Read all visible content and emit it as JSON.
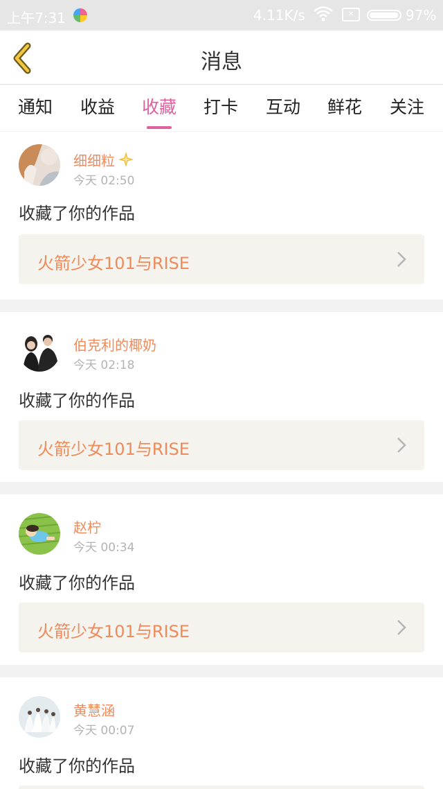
{
  "status_bar": {
    "time": "上午7:31",
    "net_speed": "4.11K/s",
    "sim_label": "✕",
    "battery_percent": 97,
    "battery_text": "97%",
    "icons": [
      "app-notification-icon",
      "wifi-icon",
      "sim-icon",
      "battery-icon"
    ]
  },
  "header": {
    "back_icon": "chevron-left-icon",
    "title": "消息"
  },
  "tabs": [
    {
      "label": "通知"
    },
    {
      "label": "收益"
    },
    {
      "label": "收藏",
      "active": true
    },
    {
      "label": "打卡"
    },
    {
      "label": "互动"
    },
    {
      "label": "鲜花"
    },
    {
      "label": "关注"
    }
  ],
  "messages": [
    {
      "user": "细细粒",
      "badge_icon": "sparkle-icon",
      "time": "今天 02:50",
      "text": "收藏了你的作品",
      "work": "火箭少女101与RISE"
    },
    {
      "user": "伯克利的椰奶",
      "time": "今天 02:18",
      "text": "收藏了你的作品",
      "work": "火箭少女101与RISE"
    },
    {
      "user": "赵柠",
      "time": "今天 00:34",
      "text": "收藏了你的作品",
      "work": "火箭少女101与RISE"
    },
    {
      "user": "黄慧涵",
      "time": "今天 00:07",
      "text": "收藏了你的作品",
      "work": ""
    }
  ],
  "colors": {
    "accent_pink": "#e0609f",
    "username_orange": "#ef8a5a",
    "work_box_bg": "#f4f3ee",
    "page_bg": "#f2f2f2"
  }
}
